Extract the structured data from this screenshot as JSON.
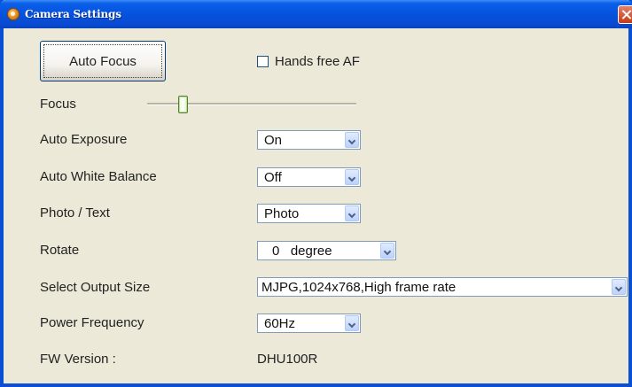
{
  "window": {
    "title": "Camera Settings"
  },
  "controls": {
    "auto_focus_button": "Auto Focus",
    "hands_free_af": {
      "label": "Hands free AF",
      "checked": false
    },
    "focus": {
      "label": "Focus"
    },
    "auto_exposure": {
      "label": "Auto Exposure",
      "value": "On"
    },
    "auto_white_balance": {
      "label": "Auto White Balance",
      "value": "Off"
    },
    "photo_text": {
      "label": "Photo / Text",
      "value": "Photo"
    },
    "rotate": {
      "label": "Rotate",
      "value": "0   degree"
    },
    "output_size": {
      "label": "Select Output Size",
      "value": "MJPG,1024x768,High frame rate"
    },
    "power_frequency": {
      "label": "Power Frequency",
      "value": "60Hz"
    },
    "fw_version": {
      "label": "FW Version :",
      "value": "DHU100R"
    }
  }
}
